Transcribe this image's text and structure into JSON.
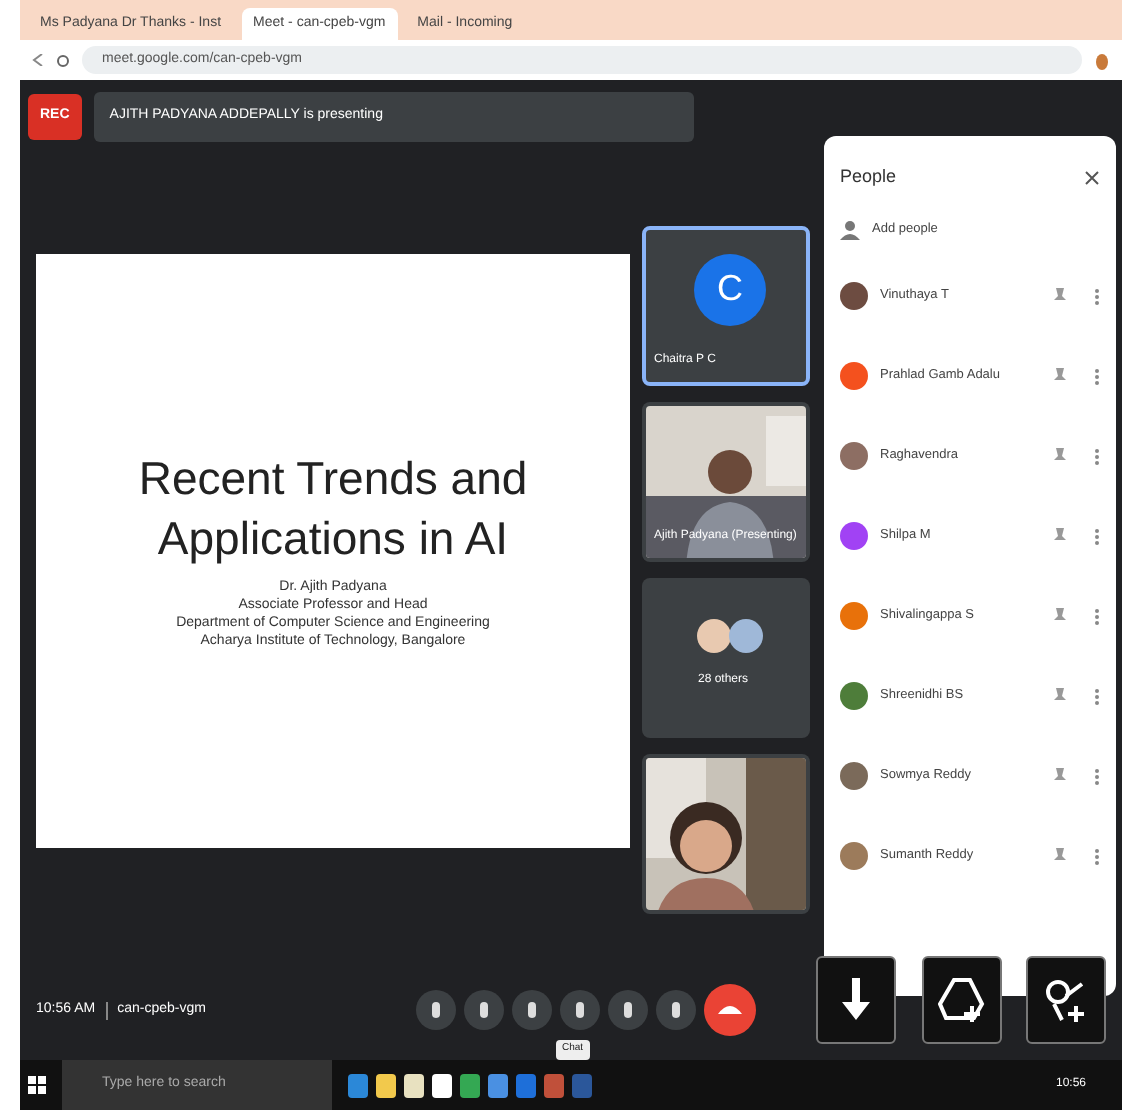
{
  "browser": {
    "tabs": [
      {
        "title": "Ms Padyana Dr Thanks - Inst",
        "selected": false
      },
      {
        "title": "Meet - can-cpeb-vgm",
        "selected": true
      },
      {
        "title": "Mail - Incoming",
        "selected": false
      }
    ],
    "url": "meet.google.com/can-cpeb-vgm"
  },
  "meeting": {
    "rec_badge": "REC",
    "presenter_banner": "AJITH PADYANA ADDEPALLY is presenting",
    "slide": {
      "title": "Recent Trends and Applications in AI",
      "lines": [
        "Dr. Ajith Padyana",
        "Associate Professor and Head",
        "Department of Computer Science and Engineering",
        "Acharya Institute of Technology, Bangalore"
      ]
    },
    "tiles": [
      {
        "kind": "avatar",
        "initial": "C",
        "name": "Chaitra P C",
        "selected": true
      },
      {
        "kind": "video",
        "name": "Ajith Padyana (Presenting)",
        "selected": false
      },
      {
        "kind": "group",
        "name": "28 others",
        "selected": false
      },
      {
        "kind": "video",
        "selected": false
      }
    ],
    "time": "10:56 AM",
    "code": "can-cpeb-vgm",
    "tooltip": "Chat"
  },
  "people": {
    "title": "People",
    "add": "Add people",
    "list": [
      {
        "name": "Vinuthaya T",
        "color": "#6d4c41"
      },
      {
        "name": "Prahlad Gamb Adalu",
        "color": "#f4511e"
      },
      {
        "name": "Raghavendra",
        "color": "#8d6e63"
      },
      {
        "name": "Shilpa M",
        "color": "#a142f4"
      },
      {
        "name": "Shivalingappa S",
        "color": "#e8710a"
      },
      {
        "name": "Shreenidhi BS",
        "color": "#4e7d3a"
      },
      {
        "name": "Sowmya Reddy",
        "color": "#7b6a5a"
      },
      {
        "name": "Sumanth Reddy",
        "color": "#9c7b5b"
      }
    ]
  },
  "taskbar": {
    "search_placeholder": "Type here to search",
    "clock": "10:56"
  }
}
